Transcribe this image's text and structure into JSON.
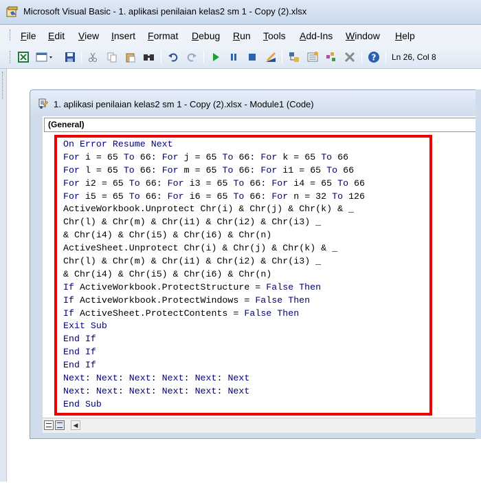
{
  "window": {
    "title": "Microsoft Visual Basic - 1. aplikasi penilaian kelas2 sm 1 - Copy (2).xlsx"
  },
  "menu": {
    "items": [
      {
        "first": "F",
        "rest": "ile"
      },
      {
        "first": "E",
        "rest": "dit"
      },
      {
        "first": "V",
        "rest": "iew"
      },
      {
        "first": "I",
        "rest": "nsert"
      },
      {
        "first": "F",
        "rest": "ormat"
      },
      {
        "first": "D",
        "rest": "ebug"
      },
      {
        "first": "R",
        "rest": "un"
      },
      {
        "first": "T",
        "rest": "ools"
      },
      {
        "first": "A",
        "rest": "dd-Ins"
      },
      {
        "first": "W",
        "rest": "indow"
      },
      {
        "first": "H",
        "rest": "elp"
      }
    ]
  },
  "toolbar": {
    "icons": [
      "excel-icon",
      "insert-module-icon",
      "save-icon",
      "cut-icon",
      "copy-icon",
      "paste-icon",
      "find-icon",
      "undo-icon",
      "redo-icon",
      "run-icon",
      "break-icon",
      "reset-icon",
      "design-mode-icon",
      "project-explorer-icon",
      "properties-icon",
      "object-browser-icon",
      "toolbox-icon",
      "help-icon"
    ],
    "cursor_position": "Ln 26, Col 8"
  },
  "code_window": {
    "title": "1. aplikasi penilaian kelas2 sm 1 - Copy (2).xlsx - Module1 (Code)",
    "object_combo": "(General)"
  },
  "code": {
    "lines": [
      "On Error Resume Next",
      "For i = 65 To 66: For j = 65 To 66: For k = 65 To 66",
      "For l = 65 To 66: For m = 65 To 66: For i1 = 65 To 66",
      "For i2 = 65 To 66: For i3 = 65 To 66: For i4 = 65 To 66",
      "For i5 = 65 To 66: For i6 = 65 To 66: For n = 32 To 126",
      "ActiveWorkbook.Unprotect Chr(i) & Chr(j) & Chr(k) & _",
      "Chr(l) & Chr(m) & Chr(i1) & Chr(i2) & Chr(i3) _",
      "& Chr(i4) & Chr(i5) & Chr(i6) & Chr(n)",
      "ActiveSheet.Unprotect Chr(i) & Chr(j) & Chr(k) & _",
      "Chr(l) & Chr(m) & Chr(i1) & Chr(i2) & Chr(i3) _",
      "& Chr(i4) & Chr(i5) & Chr(i6) & Chr(n)",
      "If ActiveWorkbook.ProtectStructure = False Then",
      "If ActiveWorkbook.ProtectWindows = False Then",
      "If ActiveSheet.ProtectContents = False Then",
      "Exit Sub",
      "End If",
      "End If",
      "End If",
      "Next: Next: Next: Next: Next: Next",
      "Next: Next: Next: Next: Next: Next",
      "End Sub"
    ],
    "keywords": [
      "On",
      "Error",
      "Resume",
      "Next",
      "For",
      "To",
      "If",
      "Then",
      "False",
      "Exit",
      "Sub",
      "End"
    ]
  },
  "colors": {
    "keyword": "#00007f",
    "highlight_border": "#ee0000"
  }
}
